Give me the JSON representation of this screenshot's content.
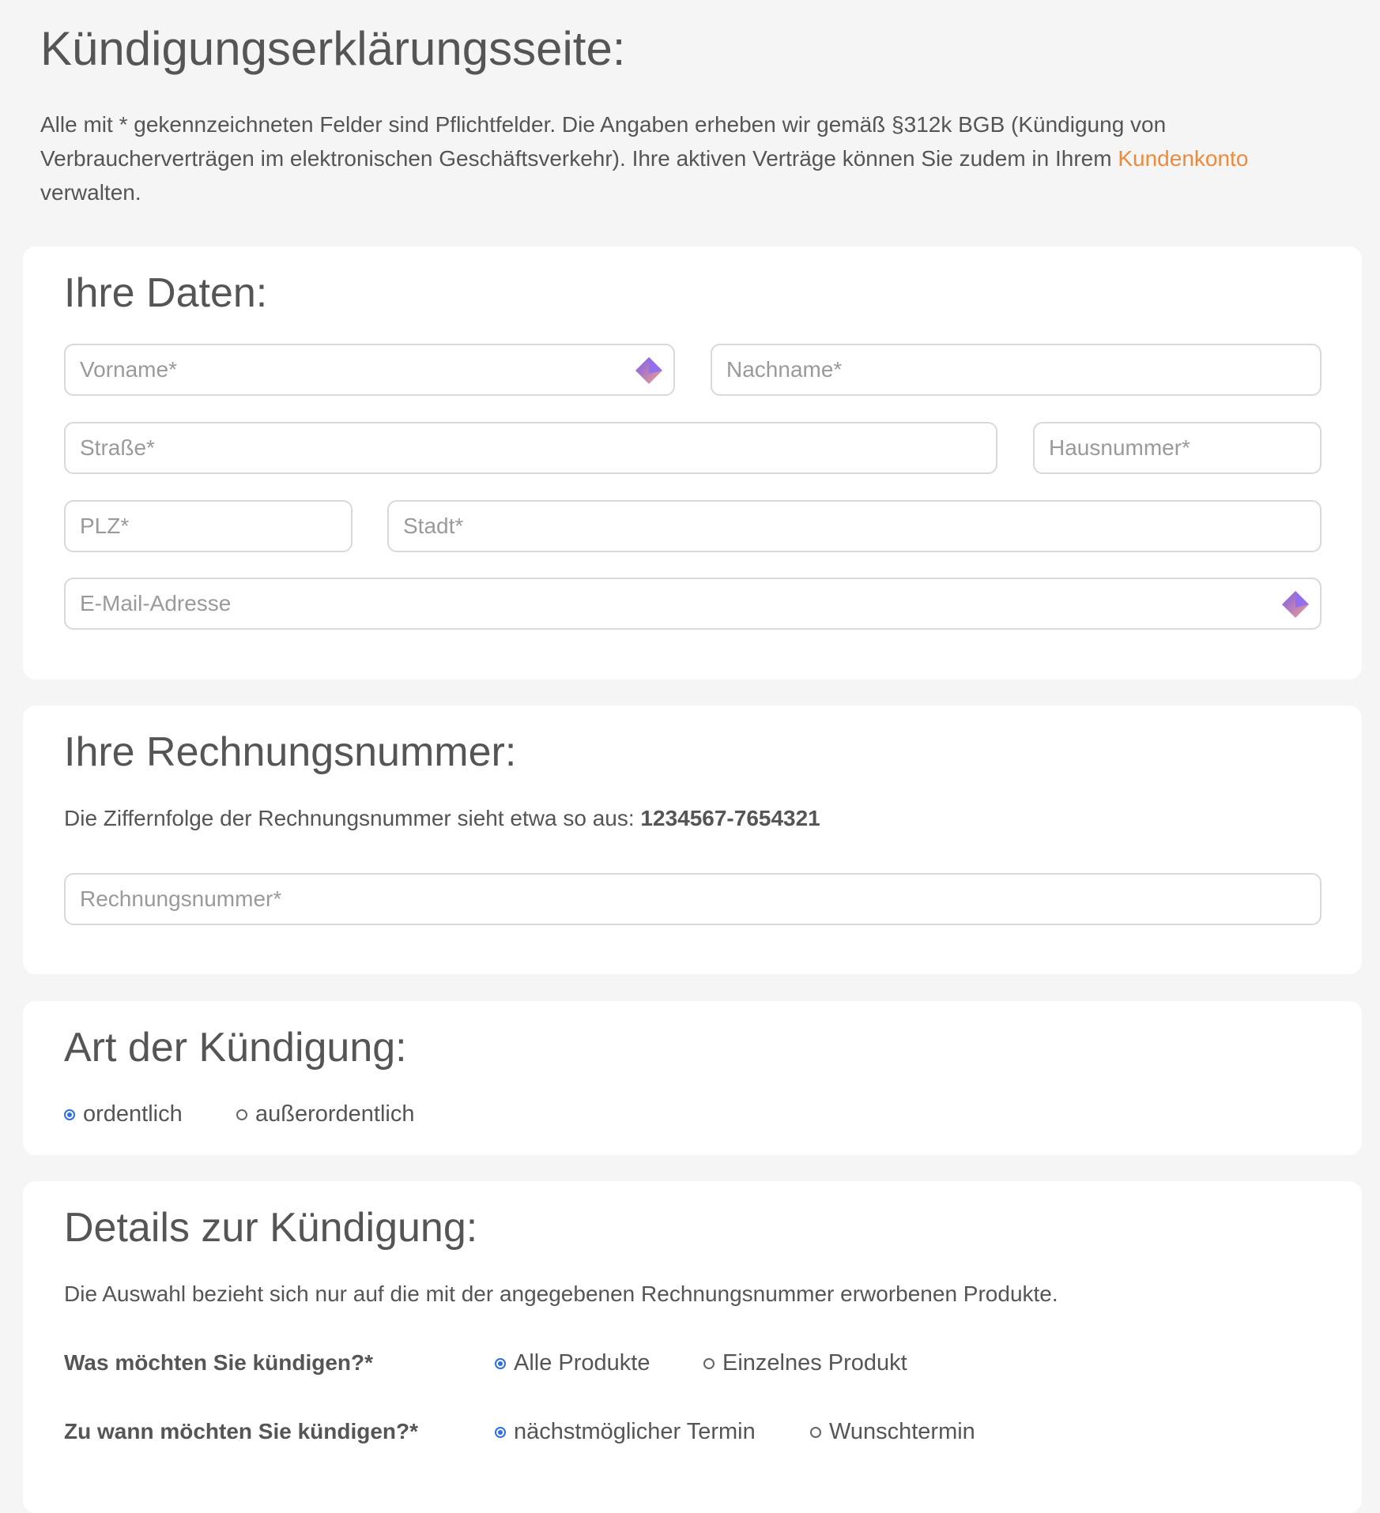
{
  "page": {
    "title": "Kündigungserklärungsseite:",
    "intro_before_link": "Alle mit * gekennzeichneten Felder sind Pflichtfelder. Die Angaben erheben wir gemäß §312k BGB (Kündigung von Verbraucherverträgen im elektronischen Geschäftsverkehr). Ihre aktiven Verträge können Sie zudem in Ihrem ",
    "intro_link": "Kundenkonto",
    "intro_after_link": " verwalten.",
    "link_color": "#ef8a3b"
  },
  "personal": {
    "title": "Ihre Daten:",
    "fields": {
      "first_name": {
        "placeholder": "Vorname*",
        "value": ""
      },
      "last_name": {
        "placeholder": "Nachname*",
        "value": ""
      },
      "street": {
        "placeholder": "Straße*",
        "value": ""
      },
      "house_number": {
        "placeholder": "Hausnummer*",
        "value": ""
      },
      "zip": {
        "placeholder": "PLZ*",
        "value": ""
      },
      "city": {
        "placeholder": "Stadt*",
        "value": ""
      },
      "email": {
        "placeholder": "E-Mail-Adresse",
        "value": ""
      }
    },
    "autofill_icon": "autofill-gem-icon"
  },
  "invoice": {
    "title": "Ihre Rechnungsnummer:",
    "hint": "Die Ziffernfolge der Rechnungsnummer sieht etwa so aus: ",
    "example": "1234567-7654321",
    "field": {
      "placeholder": "Rechnungsnummer*",
      "value": ""
    }
  },
  "type": {
    "title": "Art der Kündigung:",
    "options": [
      {
        "label": "ordentlich",
        "selected": true
      },
      {
        "label": "außerordentlich",
        "selected": false
      }
    ]
  },
  "details": {
    "title": "Details zur Kündigung:",
    "hint": "Die Auswahl bezieht sich nur auf die mit der angegebenen Rechnungsnummer erworbenen Produkte.",
    "what": {
      "label": "Was möchten Sie kündigen?*",
      "options": [
        {
          "label": "Alle Produkte",
          "selected": true
        },
        {
          "label": "Einzelnes Produkt",
          "selected": false
        }
      ]
    },
    "when": {
      "label": "Zu wann möchten Sie kündigen?*",
      "options": [
        {
          "label": "nächstmöglicher Termin",
          "selected": true
        },
        {
          "label": "Wunschtermin",
          "selected": false
        }
      ]
    }
  },
  "colors": {
    "radio_selected": "#2f6fe0",
    "background": "#f5f5f5",
    "text": "#555555"
  }
}
